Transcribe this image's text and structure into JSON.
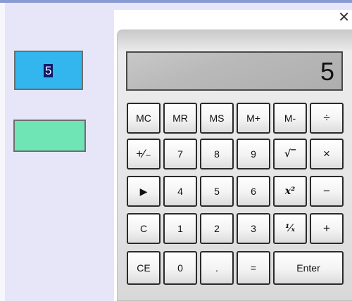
{
  "fields": {
    "first_value": "5",
    "second_value": ""
  },
  "calculator": {
    "display": "5",
    "rows": [
      [
        "MC",
        "MR",
        "MS",
        "M+",
        "M-",
        "÷"
      ],
      [
        "+⁄₋",
        "7",
        "8",
        "9",
        "√‾",
        "×"
      ],
      [
        "▶",
        "4",
        "5",
        "6",
        "x²",
        "−"
      ],
      [
        "C",
        "1",
        "2",
        "3",
        "¹⁄ₓ",
        "+"
      ],
      [
        "CE",
        "0",
        ".",
        "=",
        "Enter"
      ]
    ]
  },
  "colors": {
    "field_blue": "#33b5ee",
    "field_green": "#6fe4b4",
    "page_background": "#e6e6f8"
  },
  "icons": {
    "close": "close-icon",
    "play": "play-icon"
  }
}
